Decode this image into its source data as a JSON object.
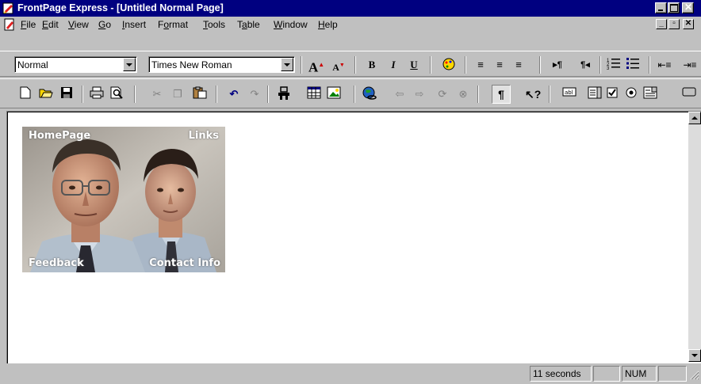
{
  "window": {
    "title": "FrontPage Express - [Untitled Normal Page]"
  },
  "menu": {
    "items": [
      {
        "key": "F",
        "rest": "ile"
      },
      {
        "key": "E",
        "rest": "dit"
      },
      {
        "key": "V",
        "rest": "iew"
      },
      {
        "key": "G",
        "rest": "o"
      },
      {
        "key": "I",
        "rest": "nsert"
      },
      {
        "key": "o",
        "pre": "F",
        "rest": "rmat"
      },
      {
        "key": "T",
        "rest": "ools"
      },
      {
        "key": "a",
        "pre": "T",
        "rest": "ble"
      },
      {
        "key": "W",
        "rest": "indow"
      },
      {
        "key": "H",
        "rest": "elp"
      }
    ]
  },
  "format_toolbar": {
    "style_value": "Normal",
    "font_value": "Times New Roman",
    "icons": [
      "increase-font-icon",
      "decrease-font-icon",
      "bold-icon",
      "italic-icon",
      "underline-icon",
      "text-color-icon",
      "align-left-icon",
      "align-center-icon",
      "align-right-icon",
      "ltr-icon",
      "rtl-icon",
      "numbered-list-icon",
      "bulleted-list-icon",
      "decrease-indent-icon",
      "increase-indent-icon"
    ]
  },
  "standard_toolbar": {
    "icons": [
      "new-icon",
      "open-icon",
      "save-icon",
      "print-icon",
      "print-preview-icon",
      "cut-icon",
      "copy-icon",
      "paste-icon",
      "undo-icon",
      "redo-icon",
      "webbot-icon",
      "table-icon",
      "image-icon",
      "hyperlink-icon",
      "back-icon",
      "forward-icon",
      "refresh-icon",
      "stop-icon",
      "show-formatting-icon",
      "help-icon",
      "textbox-icon",
      "scrolling-textbox-icon",
      "checkbox-icon",
      "radio-button-icon",
      "dropdown-menu-icon",
      "push-button-icon"
    ]
  },
  "document": {
    "image_labels": {
      "top_left": "HomePage",
      "top_right": "Links",
      "bottom_left": "Feedback",
      "bottom_right": "Contact Info"
    }
  },
  "status": {
    "time": "11 seconds",
    "num": "NUM"
  },
  "colors": {
    "titlebar": "#000080",
    "face": "#c0c0c0"
  }
}
